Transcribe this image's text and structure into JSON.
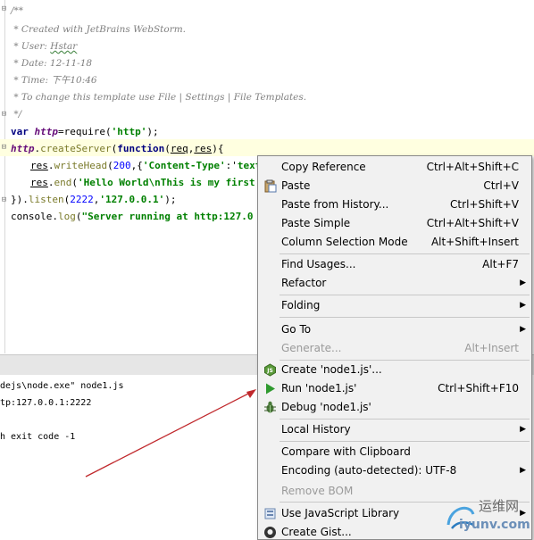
{
  "editor": {
    "comment_open": "/**",
    "comment_created": " * Created with JetBrains WebStorm.",
    "comment_user_prefix": " * User: ",
    "comment_user_name": "Hstar",
    "comment_date": " * Date: 12-11-18",
    "comment_time": " * Time: 下午10:46",
    "comment_change": " * To change this template use File | Settings | File Templates.",
    "comment_close": " */",
    "l9_kw": "var ",
    "l9_var": "http",
    "l9_a": "=require(",
    "l9_str": "'http'",
    "l9_b": ");",
    "l10_var": "http",
    "l10_a": ".",
    "l10_fn": "createServer",
    "l10_b": "(",
    "l10_kw": "function",
    "l10_c": "(",
    "l10_p1": "req",
    "l10_d": ",",
    "l10_p2": "res",
    "l10_e": "){",
    "l11_p": "res",
    "l11_a": ".",
    "l11_fn": "writeHead",
    "l11_b": "(",
    "l11_num": "200",
    "l11_c": ",{",
    "l11_str": "'Content-Type'",
    "l11_d": ":'",
    "l11_str2": "text",
    "l12_p": "res",
    "l12_a": ".",
    "l12_fn": "end",
    "l12_b": "(",
    "l12_str": "'Hello World\\nThis is my first",
    "l13_a": "}).",
    "l13_fn": "listen",
    "l13_b": "(",
    "l13_num": "2222",
    "l13_c": ",",
    "l13_str": "'127.0.0.1'",
    "l13_d": ");",
    "l14_p": "console",
    "l14_a": ".",
    "l14_fn": "log",
    "l14_b": "(",
    "l14_str": "\"Server running at http:127.0"
  },
  "console": {
    "line1": "dejs\\node.exe\" node1.js",
    "line2": "tp:127.0.0.1:2222",
    "line3": "h exit code -1"
  },
  "menu": {
    "copy_reference": "Copy Reference",
    "copy_reference_sc": "Ctrl+Alt+Shift+C",
    "paste": "Paste",
    "paste_sc": "Ctrl+V",
    "paste_history": "Paste from History...",
    "paste_history_sc": "Ctrl+Shift+V",
    "paste_simple": "Paste Simple",
    "paste_simple_sc": "Ctrl+Alt+Shift+V",
    "column_selection": "Column Selection Mode",
    "column_selection_sc": "Alt+Shift+Insert",
    "find_usages": "Find Usages...",
    "find_usages_sc": "Alt+F7",
    "refactor": "Refactor",
    "folding": "Folding",
    "go_to": "Go To",
    "generate": "Generate...",
    "generate_sc": "Alt+Insert",
    "create_config": "Create 'node1.js'...",
    "run": "Run 'node1.js'",
    "run_sc": "Ctrl+Shift+F10",
    "debug": "Debug 'node1.js'",
    "local_history": "Local History",
    "compare_clipboard": "Compare with Clipboard",
    "encoding": "Encoding (auto-detected): UTF-8",
    "remove_bom": "Remove BOM",
    "use_js_library": "Use JavaScript Library",
    "create_gist": "Create Gist..."
  },
  "watermark": {
    "line1": "运维网",
    "line2": "iyunv.com"
  },
  "colors": {
    "menu_bg": "#f1f1f1",
    "current_line": "#ffffe0",
    "run_green": "#2f9a2f",
    "annotation_arrow": "#c0282c"
  }
}
